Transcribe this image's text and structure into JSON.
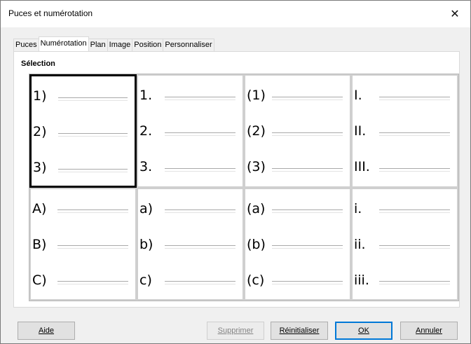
{
  "window": {
    "title": "Puces et numérotation",
    "close_glyph": "✕"
  },
  "tabs": [
    {
      "label": "Puces",
      "active": false
    },
    {
      "label": "Numérotation",
      "active": true
    },
    {
      "label": "Plan",
      "active": false
    },
    {
      "label": "Image",
      "active": false
    },
    {
      "label": "Position",
      "active": false
    },
    {
      "label": "Personnaliser",
      "active": false
    }
  ],
  "selection": {
    "label": "Sélection",
    "cells": [
      [
        "1)",
        "2)",
        "3)"
      ],
      [
        "1.",
        "2.",
        "3."
      ],
      [
        "(1)",
        "(2)",
        "(3)"
      ],
      [
        "I.",
        "II.",
        "III."
      ],
      [
        "A)",
        "B)",
        "C)"
      ],
      [
        "a)",
        "b)",
        "c)"
      ],
      [
        "(a)",
        "(b)",
        "(c)"
      ],
      [
        "i.",
        "ii.",
        "iii."
      ]
    ],
    "selected_index": 0
  },
  "buttons": {
    "help": "Aide",
    "delete": "Supprimer",
    "reset": "Réinitialiser",
    "ok": "OK",
    "cancel": "Annuler"
  }
}
